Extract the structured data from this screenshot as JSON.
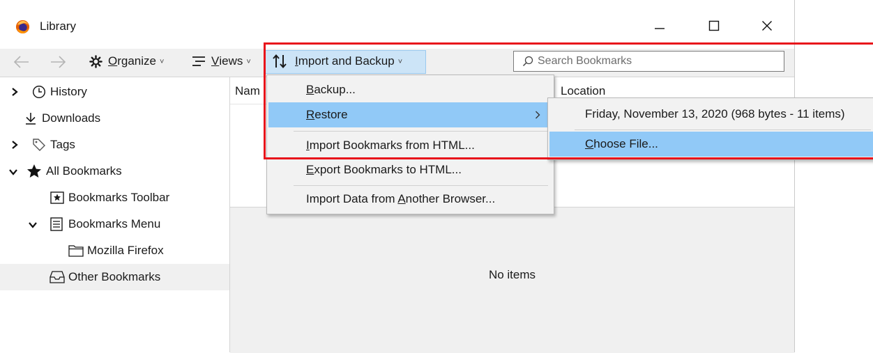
{
  "window": {
    "title": "Library",
    "controls": {
      "minimize": "minimize",
      "maximize": "maximize",
      "close": "close"
    }
  },
  "toolbar": {
    "organize": {
      "pre": "",
      "u": "O",
      "post": "rganize"
    },
    "views": {
      "pre": "",
      "u": "V",
      "post": "iews"
    },
    "import_backup": {
      "pre": "",
      "u": "I",
      "post": "mport and Backup"
    },
    "search_placeholder": "Search Bookmarks"
  },
  "sidebar": {
    "items": [
      {
        "label": "History",
        "icon": "clock-icon",
        "twisty": "collapsed"
      },
      {
        "label": "Downloads",
        "icon": "download-icon",
        "twisty": "none"
      },
      {
        "label": "Tags",
        "icon": "tag-icon",
        "twisty": "collapsed"
      },
      {
        "label": "All Bookmarks",
        "icon": "star-icon",
        "twisty": "expanded"
      },
      {
        "label": "Bookmarks Toolbar",
        "icon": "bookmark-toolbar-icon",
        "twisty": "none"
      },
      {
        "label": "Bookmarks Menu",
        "icon": "bookmark-menu-icon",
        "twisty": "expanded"
      },
      {
        "label": "Mozilla Firefox",
        "icon": "folder-icon",
        "twisty": "none"
      },
      {
        "label": "Other Bookmarks",
        "icon": "inbox-icon",
        "twisty": "none",
        "selected": true
      }
    ]
  },
  "content": {
    "columns": {
      "name": "Nam",
      "location": "Location"
    },
    "empty_text": "No items"
  },
  "import_menu": {
    "items": [
      {
        "pre": "",
        "u": "B",
        "post": "ackup..."
      },
      {
        "pre": "",
        "u": "R",
        "post": "estore",
        "submenu": true,
        "highlighted": true
      },
      {
        "pre": "",
        "u": "I",
        "post": "mport Bookmarks from HTML..."
      },
      {
        "pre": "",
        "u": "E",
        "post": "xport Bookmarks to HTML..."
      },
      {
        "pre": "Import Data from ",
        "u": "A",
        "post": "nother Browser..."
      }
    ]
  },
  "restore_submenu": {
    "items": [
      {
        "pre": "Friday, November 13, 2020 (968 bytes - 11 items)",
        "u": "",
        "post": ""
      },
      {
        "pre": "",
        "u": "C",
        "post": "hoose File...",
        "highlighted": true
      }
    ]
  },
  "colors": {
    "highlight": "#91c9f7",
    "annotation": "#e8131b",
    "pressed_button": "#cce4f7"
  }
}
